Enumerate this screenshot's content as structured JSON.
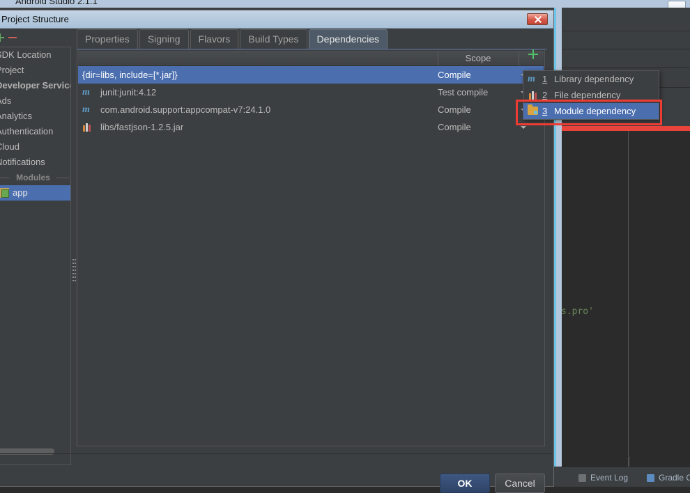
{
  "ide": {
    "title": "Android Studio 2.1.1",
    "window_minimize_icon": "minimize-icon",
    "code_snippet": "s.pro'",
    "status": {
      "event_log": "Event Log",
      "gradle_console": "Gradle C",
      "event_log_icon": "event-log-icon",
      "gradle_icon": "gradle-console-icon"
    }
  },
  "dialog": {
    "title": "Project Structure",
    "close_icon": "close-icon",
    "nav_toolbar": {
      "add_icon": "plus-icon",
      "remove_icon": "minus-icon"
    },
    "sidebar": {
      "items": [
        {
          "label": "SDK Location",
          "bold": false
        },
        {
          "label": "Project",
          "bold": false
        },
        {
          "label": "Developer Services",
          "bold": true
        },
        {
          "label": "Ads",
          "bold": false
        },
        {
          "label": "Analytics",
          "bold": false
        },
        {
          "label": "Authentication",
          "bold": false
        },
        {
          "label": "Cloud",
          "bold": false
        },
        {
          "label": "Notifications",
          "bold": false
        }
      ],
      "group_label": "Modules",
      "module": {
        "label": "app",
        "icon": "android-module-icon",
        "selected": true
      }
    },
    "tabs": [
      {
        "label": "Properties",
        "active": false
      },
      {
        "label": "Signing",
        "active": false
      },
      {
        "label": "Flavors",
        "active": false
      },
      {
        "label": "Build Types",
        "active": false
      },
      {
        "label": "Dependencies",
        "active": true
      }
    ],
    "table": {
      "headers": {
        "name": "",
        "scope": "Scope",
        "add": "+"
      },
      "add_icon": "plus-icon",
      "rows": [
        {
          "name": "{dir=libs, include=[*.jar]}",
          "scope": "Compile",
          "icon": "none",
          "selected": true
        },
        {
          "name": "junit:junit:4.12",
          "scope": "Test compile",
          "icon": "maven-icon",
          "selected": false
        },
        {
          "name": "com.android.support:appcompat-v7:24.1.0",
          "scope": "Compile",
          "icon": "maven-icon",
          "selected": false
        },
        {
          "name": "libs/fastjson-1.2.5.jar",
          "scope": "Compile",
          "icon": "library-icon",
          "selected": false
        }
      ]
    },
    "buttons": {
      "ok": "OK",
      "cancel": "Cancel"
    }
  },
  "popup": {
    "items": [
      {
        "num": "1",
        "label": "Library dependency",
        "icon": "maven-icon",
        "selected": false
      },
      {
        "num": "2",
        "label": "File dependency",
        "icon": "library-icon",
        "selected": false
      },
      {
        "num": "3",
        "label": "Module dependency",
        "icon": "module-folder-icon",
        "selected": true
      }
    ]
  },
  "annotation": {
    "highlight_color": "#ee3b33"
  }
}
